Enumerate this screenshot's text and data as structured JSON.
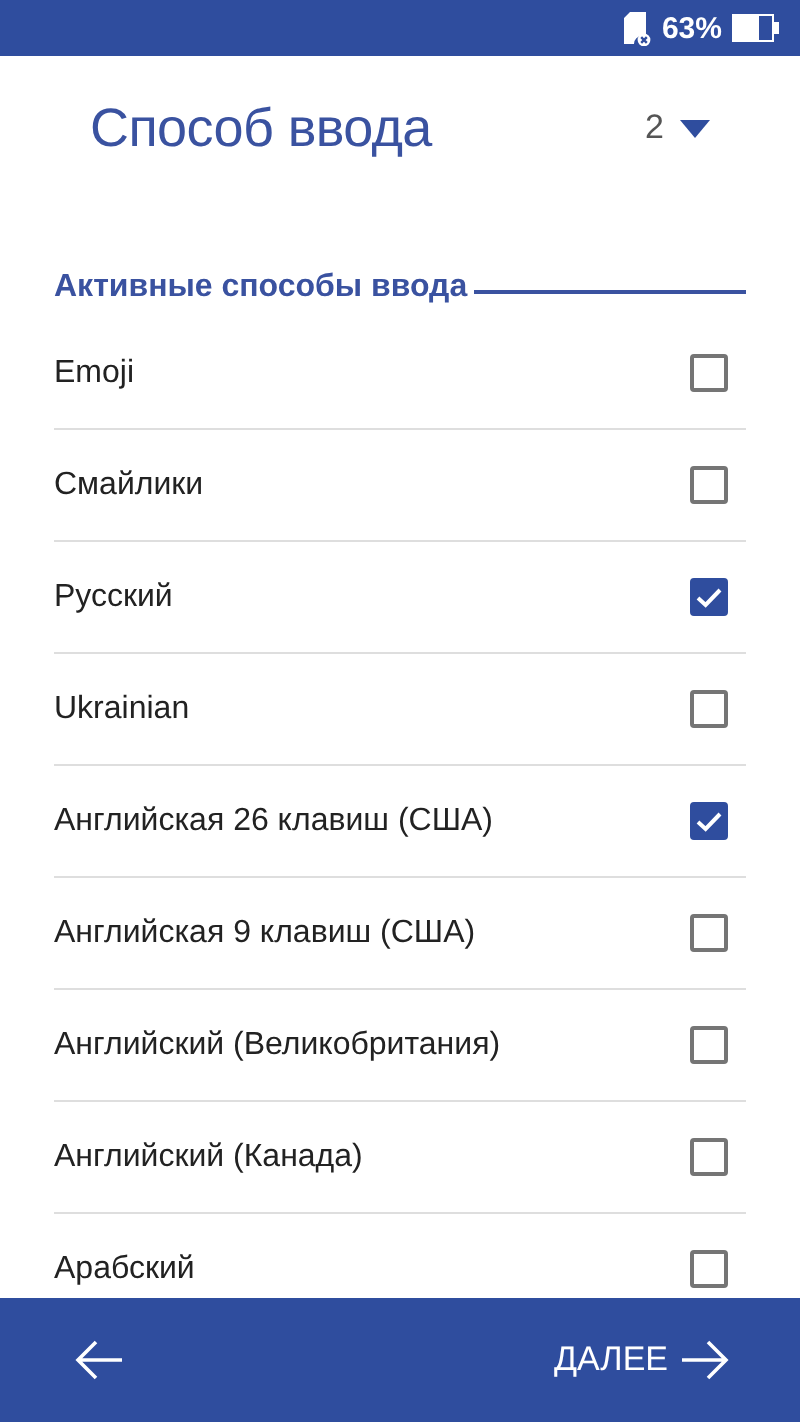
{
  "status_bar": {
    "battery_text": "63%"
  },
  "header": {
    "title": "Способ ввода",
    "page_selector": "2"
  },
  "section": {
    "title": "Активные способы ввода"
  },
  "items": [
    {
      "label": "Emoji",
      "checked": false
    },
    {
      "label": "Смайлики",
      "checked": false
    },
    {
      "label": "Русский",
      "checked": true
    },
    {
      "label": "Ukrainian",
      "checked": false
    },
    {
      "label": "Английская 26 клавиш (США)",
      "checked": true
    },
    {
      "label": "Английская 9 клавиш (США)",
      "checked": false
    },
    {
      "label": "Английский (Великобритания)",
      "checked": false
    },
    {
      "label": "Английский (Канада)",
      "checked": false
    },
    {
      "label": "Арабский",
      "checked": false
    }
  ],
  "bottom_bar": {
    "next_label": "ДАЛЕЕ"
  }
}
